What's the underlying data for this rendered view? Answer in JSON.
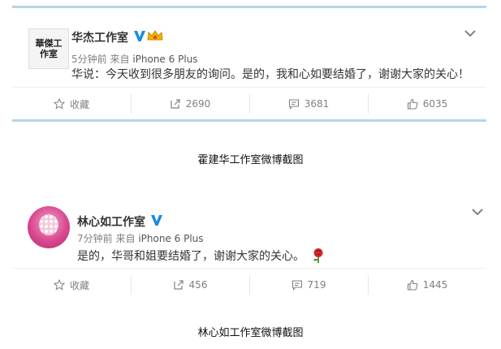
{
  "posts": [
    {
      "username": "华杰工作室",
      "avatar_text": "華傑工作室",
      "time": "5分钟前",
      "source_prefix": "来自",
      "source": "iPhone 6 Plus",
      "text": "华说：今天收到很多朋友的询问。是的，我和心如要结婚了，谢谢大家的关心！",
      "actions": {
        "favorite": "收藏",
        "repost": "2690",
        "comment": "3681",
        "like": "6035"
      }
    },
    {
      "username": "林心如工作室",
      "time": "7分钟前",
      "source_prefix": "来自",
      "source": "iPhone 6 Plus",
      "text": "是的，华哥和姐要结婚了，谢谢大家的关心。",
      "actions": {
        "favorite": "收藏",
        "repost": "456",
        "comment": "719",
        "like": "1445"
      }
    }
  ],
  "captions": [
    "霍建华工作室微博截图",
    "林心如工作室微博截图"
  ],
  "colors": {
    "divider": "#b9d4e6",
    "verified": "#1a8be0",
    "muted": "#808080"
  }
}
